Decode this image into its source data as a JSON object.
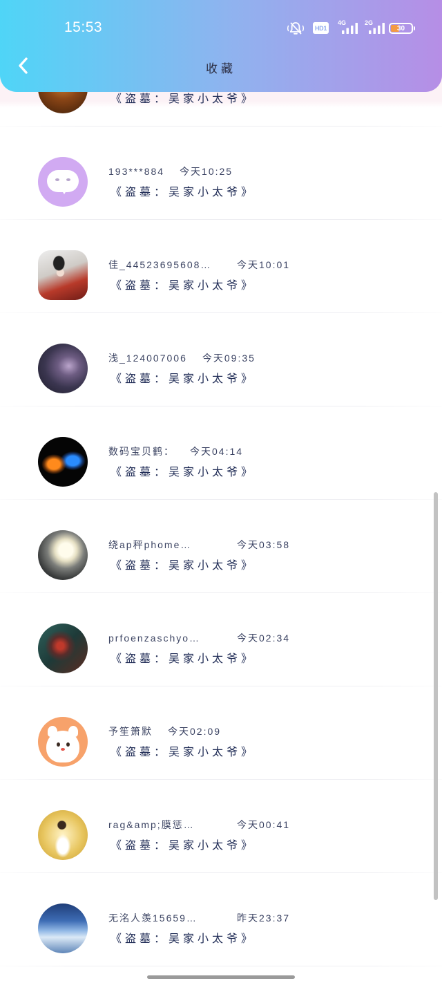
{
  "status_bar": {
    "time": "15:53",
    "hd_label": "HD1",
    "net1_label": "4G",
    "net2_label": "2G",
    "battery_percent": "30",
    "icons": [
      "mute-bell-icon",
      "hd-icon",
      "signal-4g-icon",
      "signal-2g-icon",
      "battery-icon"
    ]
  },
  "header": {
    "back_icon": "chevron-left-icon",
    "title": "收藏"
  },
  "colors": {
    "header_gradient_start": "#4fd5f7",
    "header_gradient_end": "#b68ee6",
    "title_text": "#2b2d42",
    "item_text": "#1f2b55",
    "battery_fill": "#f39a44"
  },
  "favorites": [
    {
      "book": "《盗墓：吴家小太爷》"
    },
    {
      "name": "193***884",
      "time": "今天10:25",
      "book": "《盗墓：吴家小太爷》"
    },
    {
      "name": "佳_44523695608…",
      "time": "今天10:01",
      "book": "《盗墓：吴家小太爷》"
    },
    {
      "name": "浅_124007006",
      "time": "今天09:35",
      "book": "《盗墓：吴家小太爷》"
    },
    {
      "name": "数码宝贝鹤：",
      "time": "今天04:14",
      "book": "《盗墓：吴家小太爷》"
    },
    {
      "name": "绕ap秤phome…",
      "time": "今天03:58",
      "book": "《盗墓：吴家小太爷》"
    },
    {
      "name": "prfoenzaschyo…",
      "time": "今天02:34",
      "book": "《盗墓：吴家小太爷》"
    },
    {
      "name": "予笙箫默",
      "time": "今天02:09",
      "book": "《盗墓：吴家小太爷》"
    },
    {
      "name": "rag&amp;膜惩…",
      "time": "今天00:41",
      "book": "《盗墓：吴家小太爷》"
    },
    {
      "name": "无洺人羡15659…",
      "time": "昨天23:37",
      "book": "《盗墓：吴家小太爷》"
    }
  ]
}
